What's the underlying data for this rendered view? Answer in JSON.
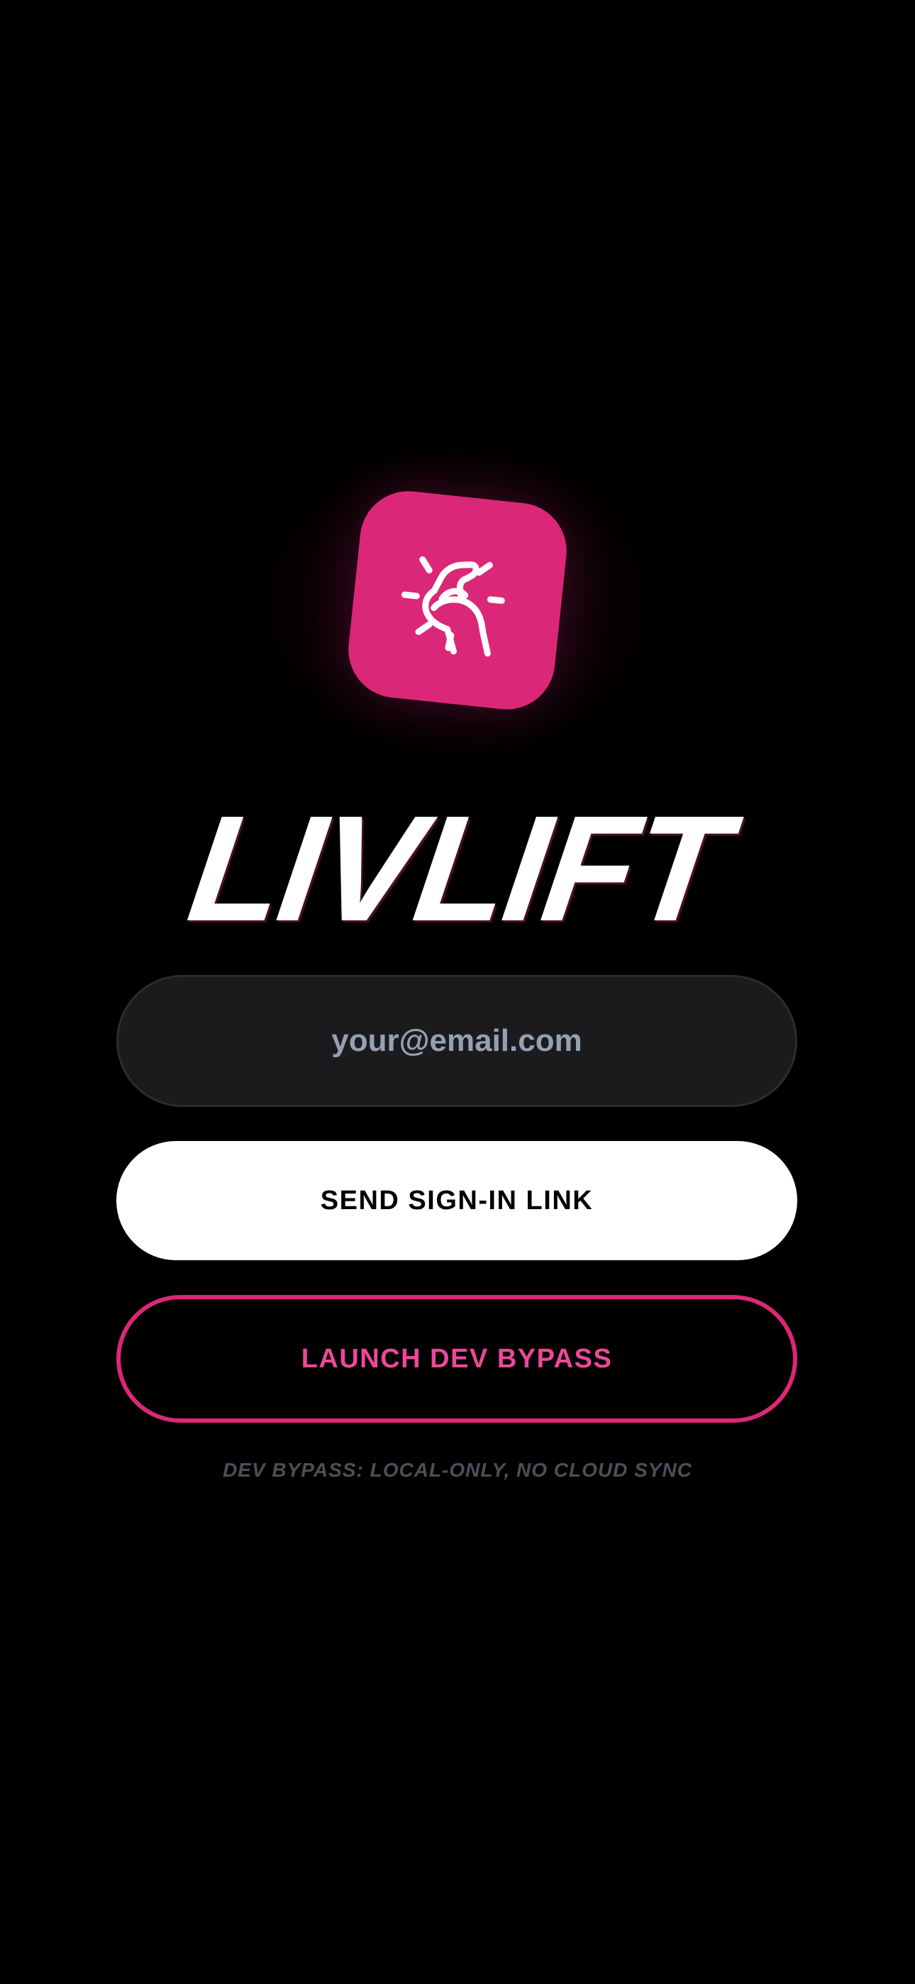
{
  "brand": {
    "name": "LIVLIFT",
    "logo_icon": "flexed-biceps-icon",
    "accent_color": "#DB2777"
  },
  "signin": {
    "email_placeholder": "your@email.com",
    "email_value": "",
    "send_link_label": "SEND SIGN-IN LINK",
    "dev_bypass_label": "LAUNCH DEV BYPASS",
    "dev_bypass_note": "DEV BYPASS: LOCAL-ONLY, NO CLOUD SYNC"
  }
}
